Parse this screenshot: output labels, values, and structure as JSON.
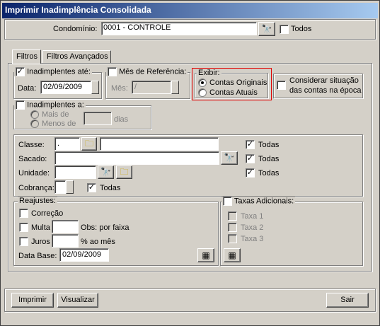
{
  "window": {
    "title": "Imprimir Inadimplência Consolidada"
  },
  "header": {
    "condominio_label": "Condomínio:",
    "condominio_value": "0001 - CONTROLE",
    "todos_label": "Todos"
  },
  "tabs": [
    {
      "label": "Filtros"
    },
    {
      "label": "Filtros Avançados"
    }
  ],
  "filtros": {
    "inadimplentes_ate_label": "Inadimplentes até:",
    "data_label": "Data:",
    "data_value": "02/09/2009",
    "mes_referencia_label": "Mês de Referência:",
    "mes_label": "Mês:",
    "mes_value": "/",
    "exibir_label": "Exibir:",
    "contas_originais_label": "Contas Originais",
    "contas_atuais_label": "Contas Atuais",
    "considerar_label_1": "Considerar situação",
    "considerar_label_2": "das contas na época",
    "inadimplentes_a_label": "Inadimplentes a:",
    "mais_de_label": "Mais de",
    "menos_de_label": "Menos de",
    "dias_label": "dias",
    "classe_label": "Classe:",
    "classe_value": ".",
    "sacado_label": "Sacado:",
    "unidade_label": "Unidade:",
    "cobranca_label": "Cobrança:",
    "todas_label": "Todas",
    "reajustes_label": "Reajustes:",
    "correcao_label": "Correção",
    "multa_label": "Multa",
    "obs_label": "Obs: por faixa",
    "juros_label": "Juros",
    "ao_mes_label": "% ao mês",
    "data_base_label": "Data Base:",
    "data_base_value": "02/09/2009",
    "taxas_adicionais_label": "Taxas Adicionais:",
    "taxa1_label": "Taxa 1",
    "taxa2_label": "Taxa 2",
    "taxa3_label": "Taxa 3"
  },
  "footer": {
    "imprimir_label": "Imprimir",
    "visualizar_label": "Visualizar",
    "sair_label": "Sair"
  }
}
